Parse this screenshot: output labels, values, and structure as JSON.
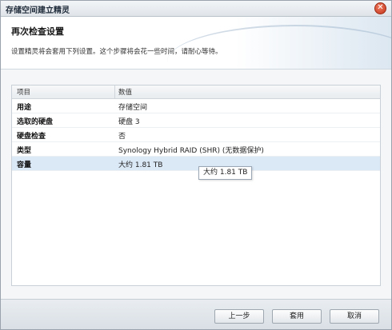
{
  "window": {
    "title": "存储空间建立精灵"
  },
  "header": {
    "title": "再次检查设置",
    "description": "设置精灵将会套用下列设置。这个步骤将会花一些时间，请耐心等待。"
  },
  "grid": {
    "columns": [
      "项目",
      "数值"
    ],
    "rows": [
      {
        "key": "用途",
        "value": "存储空间"
      },
      {
        "key": "选取的硬盘",
        "value": "硬盘 3"
      },
      {
        "key": "硬盘检查",
        "value": "否"
      },
      {
        "key": "类型",
        "value": "Synology Hybrid RAID (SHR) (无数据保护)"
      },
      {
        "key": "容量",
        "value": "大约 1.81 TB"
      }
    ],
    "selected_row": 4
  },
  "tooltip": {
    "text": "大约 1.81 TB"
  },
  "footer": {
    "back_label": "上一步",
    "apply_label": "套用",
    "cancel_label": "取消"
  },
  "icons": {
    "close": "close-icon"
  }
}
